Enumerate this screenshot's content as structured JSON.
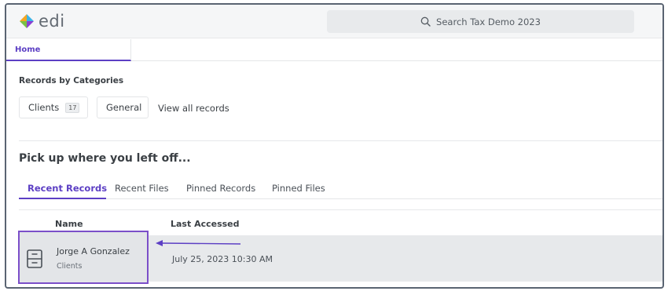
{
  "app": {
    "logo_text": "edi",
    "brand_colors": [
      "#3bb3e6",
      "#7ac143",
      "#f5a623",
      "#8b3fd1"
    ]
  },
  "search": {
    "placeholder": "Search Tax Demo 2023",
    "icon": "search-icon"
  },
  "tabs": {
    "home_label": "Home"
  },
  "categories": {
    "title": "Records by Categories",
    "clients_label": "Clients",
    "clients_count": "17",
    "general_label": "General",
    "view_all_label": "View all records"
  },
  "pickup": {
    "title": "Pick up where you left off...",
    "tabs": [
      "Recent Records",
      "Recent Files",
      "Pinned Records",
      "Pinned Files"
    ],
    "active_tab": "Recent Records"
  },
  "table": {
    "columns": {
      "name": "Name",
      "last_accessed": "Last Accessed"
    },
    "rows": [
      {
        "name": "Jorge A Gonzalez",
        "category": "Clients",
        "last_accessed": "July 25, 2023 10:30 AM",
        "icon": "file-cabinet-icon"
      }
    ]
  },
  "colors": {
    "accent": "#5c3fc4",
    "highlight_border": "#7b4fc9"
  }
}
